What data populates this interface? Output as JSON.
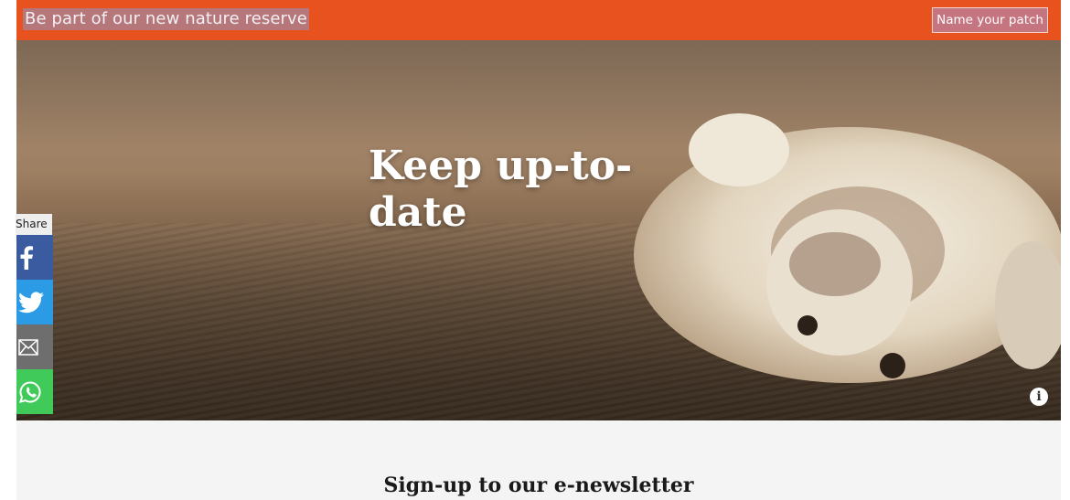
{
  "banner": {
    "text": "Be part of our new nature reserve",
    "button_label": "Name your patch",
    "background": "#e8521f"
  },
  "hero": {
    "title": "Keep up-to-date",
    "info_icon_label": "i"
  },
  "share": {
    "label": "Share",
    "items": [
      {
        "name": "facebook",
        "icon": "facebook-icon",
        "color": "#3a5ba0"
      },
      {
        "name": "twitter",
        "icon": "twitter-icon",
        "color": "#2b9be5"
      },
      {
        "name": "email",
        "icon": "email-icon",
        "color": "#6e6e6e"
      },
      {
        "name": "whatsapp",
        "icon": "whatsapp-icon",
        "color": "#3fca5a"
      }
    ]
  },
  "newsletter": {
    "title": "Sign-up to our e-newsletter"
  }
}
